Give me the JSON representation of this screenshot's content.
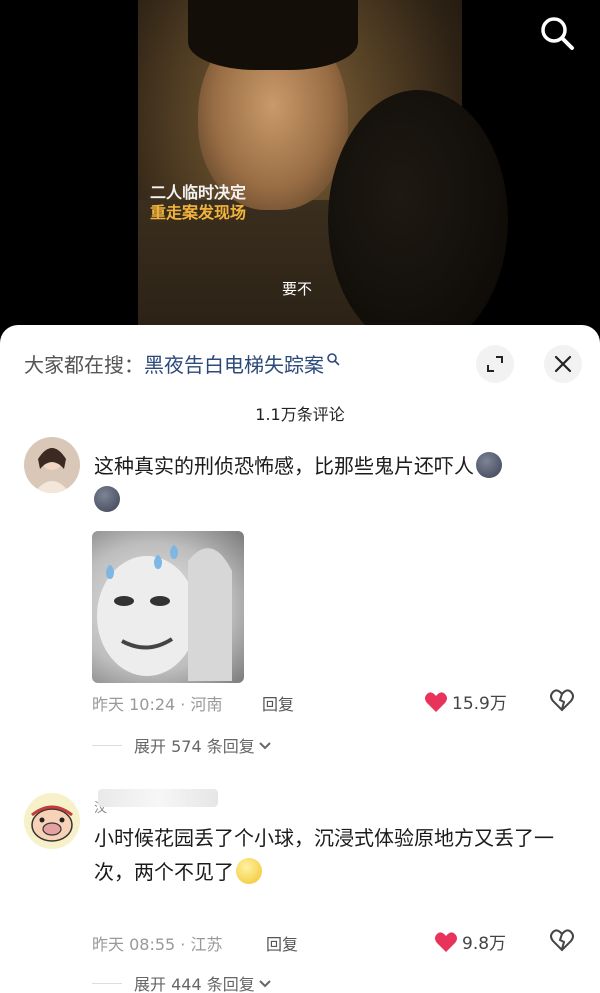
{
  "video": {
    "caption_line1": "二人临时决定",
    "caption_line2": "重走案发现场",
    "subtitle": "要不"
  },
  "sheet": {
    "search_prefix": "大家都在搜：",
    "search_term": "黑夜告白电梯失踪案",
    "comment_count": "1.1万条评论"
  },
  "comments": [
    {
      "text": "这种真实的刑侦恐怖感，比那些鬼片还吓人",
      "time_location": "昨天 10:24 · 河南",
      "reply_label": "回复",
      "likes": "15.9万",
      "expand_label": "展开 574 条回复"
    },
    {
      "username": "汶",
      "text": "小时候花园丢了个小球，沉浸式体验原地方又丢了一次，两个不见了",
      "time_location": "昨天 08:55 · 江苏",
      "reply_label": "回复",
      "likes": "9.8万",
      "expand_label": "展开 444 条回复"
    }
  ],
  "colors": {
    "heart": "#e8345a",
    "link": "#2b4a7a",
    "caption_highlight": "#f2b33d"
  }
}
